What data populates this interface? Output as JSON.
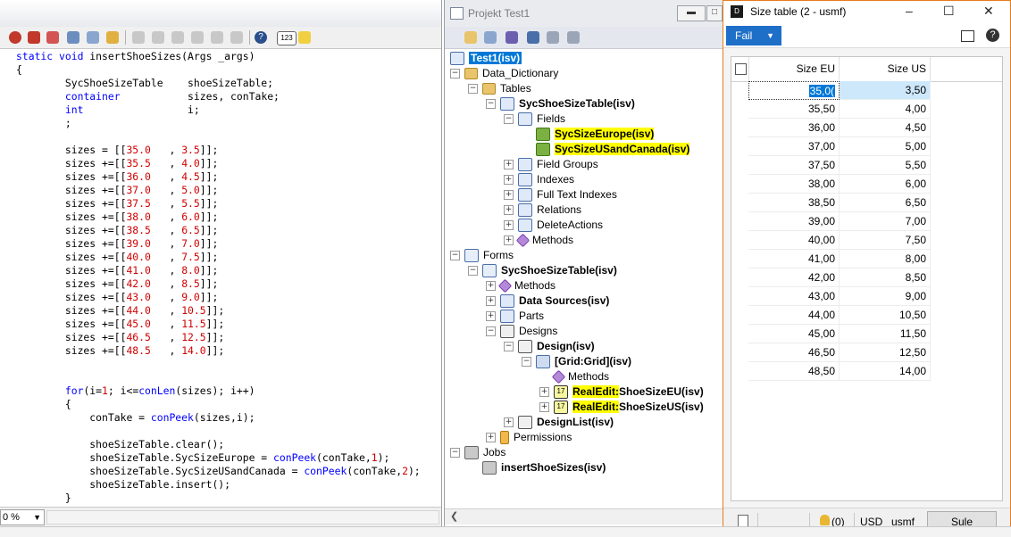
{
  "editor": {
    "code_lines": [
      [
        {
          "t": "static void ",
          "c": "kw"
        },
        {
          "t": "insertShoeSizes(Args _args)",
          "c": ""
        }
      ],
      [
        {
          "t": "{",
          "c": ""
        }
      ],
      [
        {
          "t": "        SycShoeSizeTable    shoeSizeTable;",
          "c": ""
        }
      ],
      [
        {
          "t": "        ",
          "c": ""
        },
        {
          "t": "container",
          "c": "kw"
        },
        {
          "t": "           sizes, conTake;",
          "c": ""
        }
      ],
      [
        {
          "t": "        ",
          "c": ""
        },
        {
          "t": "int",
          "c": "kw"
        },
        {
          "t": "                 i;",
          "c": ""
        }
      ],
      [
        {
          "t": "        ;",
          "c": ""
        }
      ],
      [
        {
          "t": "",
          "c": ""
        }
      ],
      [
        {
          "t": "        sizes = [[",
          "c": ""
        },
        {
          "t": "35.0",
          "c": "num"
        },
        {
          "t": "   , ",
          "c": ""
        },
        {
          "t": "3.5",
          "c": "num"
        },
        {
          "t": "]];",
          "c": ""
        }
      ],
      [
        {
          "t": "        sizes +=[[",
          "c": ""
        },
        {
          "t": "35.5",
          "c": "num"
        },
        {
          "t": "   , ",
          "c": ""
        },
        {
          "t": "4.0",
          "c": "num"
        },
        {
          "t": "]];",
          "c": ""
        }
      ],
      [
        {
          "t": "        sizes +=[[",
          "c": ""
        },
        {
          "t": "36.0",
          "c": "num"
        },
        {
          "t": "   , ",
          "c": ""
        },
        {
          "t": "4.5",
          "c": "num"
        },
        {
          "t": "]];",
          "c": ""
        }
      ],
      [
        {
          "t": "        sizes +=[[",
          "c": ""
        },
        {
          "t": "37.0",
          "c": "num"
        },
        {
          "t": "   , ",
          "c": ""
        },
        {
          "t": "5.0",
          "c": "num"
        },
        {
          "t": "]];",
          "c": ""
        }
      ],
      [
        {
          "t": "        sizes +=[[",
          "c": ""
        },
        {
          "t": "37.5",
          "c": "num"
        },
        {
          "t": "   , ",
          "c": ""
        },
        {
          "t": "5.5",
          "c": "num"
        },
        {
          "t": "]];",
          "c": ""
        }
      ],
      [
        {
          "t": "        sizes +=[[",
          "c": ""
        },
        {
          "t": "38.0",
          "c": "num"
        },
        {
          "t": "   , ",
          "c": ""
        },
        {
          "t": "6.0",
          "c": "num"
        },
        {
          "t": "]];",
          "c": ""
        }
      ],
      [
        {
          "t": "        sizes +=[[",
          "c": ""
        },
        {
          "t": "38.5",
          "c": "num"
        },
        {
          "t": "   , ",
          "c": ""
        },
        {
          "t": "6.5",
          "c": "num"
        },
        {
          "t": "]];",
          "c": ""
        }
      ],
      [
        {
          "t": "        sizes +=[[",
          "c": ""
        },
        {
          "t": "39.0",
          "c": "num"
        },
        {
          "t": "   , ",
          "c": ""
        },
        {
          "t": "7.0",
          "c": "num"
        },
        {
          "t": "]];",
          "c": ""
        }
      ],
      [
        {
          "t": "        sizes +=[[",
          "c": ""
        },
        {
          "t": "40.0",
          "c": "num"
        },
        {
          "t": "   , ",
          "c": ""
        },
        {
          "t": "7.5",
          "c": "num"
        },
        {
          "t": "]];",
          "c": ""
        }
      ],
      [
        {
          "t": "        sizes +=[[",
          "c": ""
        },
        {
          "t": "41.0",
          "c": "num"
        },
        {
          "t": "   , ",
          "c": ""
        },
        {
          "t": "8.0",
          "c": "num"
        },
        {
          "t": "]];",
          "c": ""
        }
      ],
      [
        {
          "t": "        sizes +=[[",
          "c": ""
        },
        {
          "t": "42.0",
          "c": "num"
        },
        {
          "t": "   , ",
          "c": ""
        },
        {
          "t": "8.5",
          "c": "num"
        },
        {
          "t": "]];",
          "c": ""
        }
      ],
      [
        {
          "t": "        sizes +=[[",
          "c": ""
        },
        {
          "t": "43.0",
          "c": "num"
        },
        {
          "t": "   , ",
          "c": ""
        },
        {
          "t": "9.0",
          "c": "num"
        },
        {
          "t": "]];",
          "c": ""
        }
      ],
      [
        {
          "t": "        sizes +=[[",
          "c": ""
        },
        {
          "t": "44.0",
          "c": "num"
        },
        {
          "t": "   , ",
          "c": ""
        },
        {
          "t": "10.5",
          "c": "num"
        },
        {
          "t": "]];",
          "c": ""
        }
      ],
      [
        {
          "t": "        sizes +=[[",
          "c": ""
        },
        {
          "t": "45.0",
          "c": "num"
        },
        {
          "t": "   , ",
          "c": ""
        },
        {
          "t": "11.5",
          "c": "num"
        },
        {
          "t": "]];",
          "c": ""
        }
      ],
      [
        {
          "t": "        sizes +=[[",
          "c": ""
        },
        {
          "t": "46.5",
          "c": "num"
        },
        {
          "t": "   , ",
          "c": ""
        },
        {
          "t": "12.5",
          "c": "num"
        },
        {
          "t": "]];",
          "c": ""
        }
      ],
      [
        {
          "t": "        sizes +=[[",
          "c": ""
        },
        {
          "t": "48.5",
          "c": "num"
        },
        {
          "t": "   , ",
          "c": ""
        },
        {
          "t": "14.0",
          "c": "num"
        },
        {
          "t": "]];",
          "c": ""
        }
      ],
      [
        {
          "t": "",
          "c": ""
        }
      ],
      [
        {
          "t": "",
          "c": ""
        }
      ],
      [
        {
          "t": "        ",
          "c": ""
        },
        {
          "t": "for",
          "c": "kw"
        },
        {
          "t": "(i=",
          "c": ""
        },
        {
          "t": "1",
          "c": "num"
        },
        {
          "t": "; i<=",
          "c": ""
        },
        {
          "t": "conLen",
          "c": "kw"
        },
        {
          "t": "(sizes); i++)",
          "c": ""
        }
      ],
      [
        {
          "t": "        {",
          "c": ""
        }
      ],
      [
        {
          "t": "            conTake = ",
          "c": ""
        },
        {
          "t": "conPeek",
          "c": "kw"
        },
        {
          "t": "(sizes,i);",
          "c": ""
        }
      ],
      [
        {
          "t": "",
          "c": ""
        }
      ],
      [
        {
          "t": "            shoeSizeTable.clear();",
          "c": ""
        }
      ],
      [
        {
          "t": "            shoeSizeTable.SycSizeEurope = ",
          "c": ""
        },
        {
          "t": "conPeek",
          "c": "kw"
        },
        {
          "t": "(conTake,",
          "c": ""
        },
        {
          "t": "1",
          "c": "num"
        },
        {
          "t": ");",
          "c": ""
        }
      ],
      [
        {
          "t": "            shoeSizeTable.SycSizeUSandCanada = ",
          "c": ""
        },
        {
          "t": "conPeek",
          "c": "kw"
        },
        {
          "t": "(conTake,",
          "c": ""
        },
        {
          "t": "2",
          "c": "num"
        },
        {
          "t": ");",
          "c": ""
        }
      ],
      [
        {
          "t": "            shoeSizeTable.insert();",
          "c": ""
        }
      ],
      [
        {
          "t": "        }",
          "c": ""
        }
      ]
    ],
    "zoom_value": "0 %"
  },
  "project": {
    "title": "Projekt Test1",
    "tree": [
      {
        "label": "Test1(isv)",
        "depth": 0,
        "exp": "",
        "icon": "table",
        "selected": true,
        "bold": true
      },
      {
        "label": "Data_Dictionary",
        "depth": 0,
        "exp": "-",
        "icon": "folder"
      },
      {
        "label": "Tables",
        "depth": 1,
        "exp": "-",
        "icon": "folder"
      },
      {
        "label": "SycShoeSizeTable(isv)",
        "depth": 2,
        "exp": "-",
        "icon": "table",
        "bold": true
      },
      {
        "label": "Fields",
        "depth": 3,
        "exp": "-",
        "icon": "table"
      },
      {
        "label": "SycSizeEurope(isv)",
        "depth": 4,
        "exp": "",
        "icon": "field",
        "bold": true,
        "hl": true
      },
      {
        "label": "SycSizeUSandCanada(isv)",
        "depth": 4,
        "exp": "",
        "icon": "field",
        "bold": true,
        "hl": true
      },
      {
        "label": "Field Groups",
        "depth": 3,
        "exp": "+",
        "icon": "table"
      },
      {
        "label": "Indexes",
        "depth": 3,
        "exp": "+",
        "icon": "table"
      },
      {
        "label": "Full Text Indexes",
        "depth": 3,
        "exp": "+",
        "icon": "table"
      },
      {
        "label": "Relations",
        "depth": 3,
        "exp": "+",
        "icon": "table"
      },
      {
        "label": "DeleteActions",
        "depth": 3,
        "exp": "+",
        "icon": "table"
      },
      {
        "label": "Methods",
        "depth": 3,
        "exp": "+",
        "icon": "method"
      },
      {
        "label": "Forms",
        "depth": 0,
        "exp": "-",
        "icon": "form"
      },
      {
        "label": "SycShoeSizeTable(isv)",
        "depth": 1,
        "exp": "-",
        "icon": "form",
        "bold": true
      },
      {
        "label": "Methods",
        "depth": 2,
        "exp": "+",
        "icon": "method"
      },
      {
        "label": "Data Sources(isv)",
        "depth": 2,
        "exp": "+",
        "icon": "table",
        "bold": true
      },
      {
        "label": "Parts",
        "depth": 2,
        "exp": "+",
        "icon": "table"
      },
      {
        "label": "Designs",
        "depth": 2,
        "exp": "-",
        "icon": "design"
      },
      {
        "label": "Design(isv)",
        "depth": 3,
        "exp": "-",
        "icon": "design",
        "bold": true
      },
      {
        "label": "[Grid:Grid](isv)",
        "depth": 4,
        "exp": "-",
        "icon": "grid",
        "bold": true
      },
      {
        "label": "Methods",
        "depth": 5,
        "exp": "",
        "icon": "method"
      },
      {
        "label": "RealEdit:ShoeSizeEU(isv)",
        "depth": 5,
        "exp": "+",
        "icon": "real",
        "bold": true,
        "hlprefix": "RealEdit:"
      },
      {
        "label": "RealEdit:ShoeSizeUS(isv)",
        "depth": 5,
        "exp": "+",
        "icon": "real",
        "bold": true,
        "hlprefix": "RealEdit:"
      },
      {
        "label": "DesignList(isv)",
        "depth": 3,
        "exp": "+",
        "icon": "design",
        "bold": true
      },
      {
        "label": "Permissions",
        "depth": 2,
        "exp": "+",
        "icon": "key"
      },
      {
        "label": "Jobs",
        "depth": 0,
        "exp": "-",
        "icon": "job"
      },
      {
        "label": "insertShoeSizes(isv)",
        "depth": 1,
        "exp": "",
        "icon": "job",
        "bold": true
      }
    ]
  },
  "form": {
    "title": "Size table (2 - usmf)",
    "action_button": "Fail",
    "columns": {
      "eu": "Size EU",
      "us": "Size US"
    },
    "rows": [
      [
        "35,00",
        "3,50"
      ],
      [
        "35,50",
        "4,00"
      ],
      [
        "36,00",
        "4,50"
      ],
      [
        "37,00",
        "5,00"
      ],
      [
        "37,50",
        "5,50"
      ],
      [
        "38,00",
        "6,00"
      ],
      [
        "38,50",
        "6,50"
      ],
      [
        "39,00",
        "7,00"
      ],
      [
        "40,00",
        "7,50"
      ],
      [
        "41,00",
        "8,00"
      ],
      [
        "42,00",
        "8,50"
      ],
      [
        "43,00",
        "9,00"
      ],
      [
        "44,00",
        "10,50"
      ],
      [
        "45,00",
        "11,50"
      ],
      [
        "46,50",
        "12,50"
      ],
      [
        "48,50",
        "14,00"
      ]
    ],
    "active_cell_text": "35,0(",
    "status": {
      "notifications": "(0)",
      "currency": "USD",
      "company": "usmf",
      "close_label": "Sule"
    }
  },
  "colors": {
    "keyword": "#0000ff",
    "number": "#d00000",
    "selection": "#0078d7",
    "highlight": "#ffff00",
    "form_accent": "#1e6fc8",
    "form_border": "#e87b1a"
  }
}
